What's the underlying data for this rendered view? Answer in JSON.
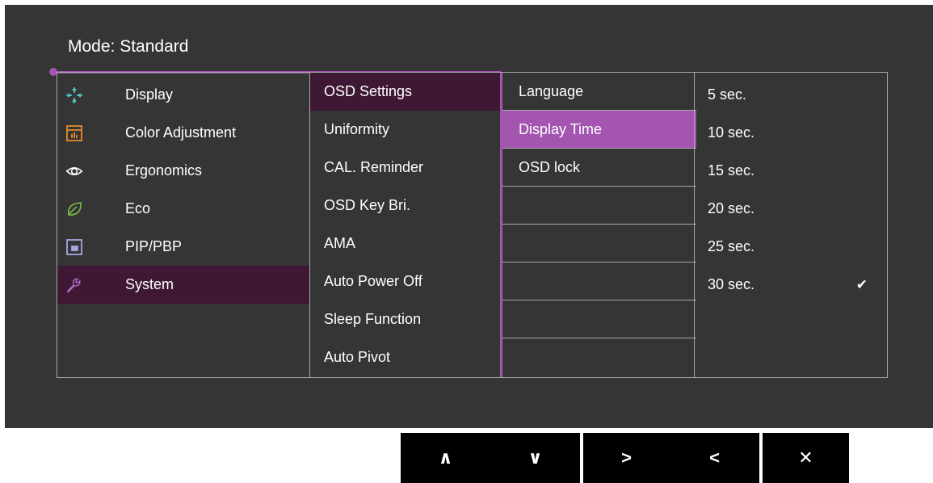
{
  "header": {
    "mode_label": "Mode: Standard"
  },
  "main_menu": [
    {
      "label": "Display",
      "icon": "display-icon"
    },
    {
      "label": "Color Adjustment",
      "icon": "color-adjustment-icon"
    },
    {
      "label": "Ergonomics",
      "icon": "eye-icon"
    },
    {
      "label": "Eco",
      "icon": "leaf-icon"
    },
    {
      "label": "PIP/PBP",
      "icon": "pip-icon"
    },
    {
      "label": "System",
      "icon": "wrench-icon",
      "selected": true
    }
  ],
  "submenu": [
    {
      "label": "OSD Settings",
      "selected": true
    },
    {
      "label": "Uniformity"
    },
    {
      "label": "CAL. Reminder"
    },
    {
      "label": "OSD Key Bri."
    },
    {
      "label": "AMA"
    },
    {
      "label": "Auto Power Off"
    },
    {
      "label": "Sleep Function"
    },
    {
      "label": "Auto Pivot"
    }
  ],
  "osd_settings": [
    {
      "label": "Language"
    },
    {
      "label": "Display Time",
      "selected": true
    },
    {
      "label": "OSD lock"
    },
    {
      "label": ""
    },
    {
      "label": ""
    },
    {
      "label": ""
    },
    {
      "label": ""
    },
    {
      "label": ""
    }
  ],
  "display_time_options": [
    {
      "label": "5 sec."
    },
    {
      "label": "10 sec."
    },
    {
      "label": "15 sec."
    },
    {
      "label": "20 sec."
    },
    {
      "label": "25 sec."
    },
    {
      "label": "30 sec.",
      "checked": true
    }
  ],
  "nav_buttons": [
    {
      "glyph": "∧",
      "icon": "up-arrow-icon"
    },
    {
      "glyph": "∨",
      "icon": "down-arrow-icon"
    },
    {
      "glyph": ">",
      "icon": "right-arrow-icon"
    },
    {
      "glyph": "<",
      "icon": "left-arrow-icon"
    },
    {
      "glyph": "✕",
      "icon": "close-icon"
    }
  ],
  "colors": {
    "accent": "#a355b0",
    "selected_dark": "#3e1835",
    "icon_cyan": "#4ec9c9",
    "icon_orange": "#e88a2a",
    "icon_green": "#7ac142",
    "icon_lavender": "#a6a6e0",
    "icon_purple": "#b56cc8",
    "background": "#353535"
  }
}
